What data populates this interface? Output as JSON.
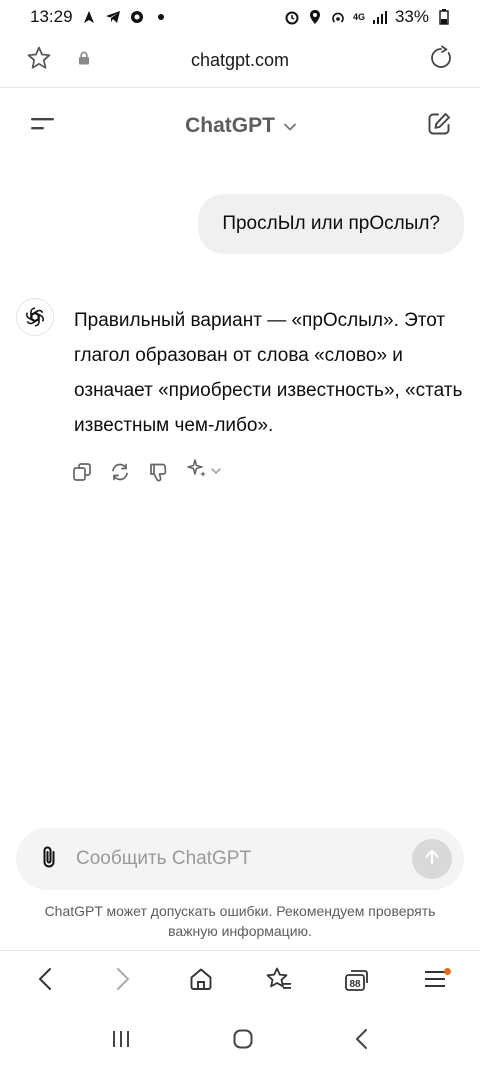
{
  "status": {
    "time": "13:29",
    "network": "4G",
    "battery": "33%"
  },
  "browser": {
    "url": "chatgpt.com"
  },
  "header": {
    "model": "ChatGPT"
  },
  "conversation": {
    "user_message": "ПрослЫл или прОслыл?",
    "assistant_message": "Правильный вариант — «прОслыл». Этот глагол образован от слова «слово» и означает «приобрести известность», «стать известным чем-либо»."
  },
  "composer": {
    "placeholder": "Сообщить ChatGPT"
  },
  "disclaimer": "ChatGPT может допускать ошибки. Рекомендуем проверять важную информацию.",
  "colors": {
    "notification_dot": "#e86a17",
    "bubble": "#f0f0f0",
    "composer": "#f4f4f4"
  }
}
